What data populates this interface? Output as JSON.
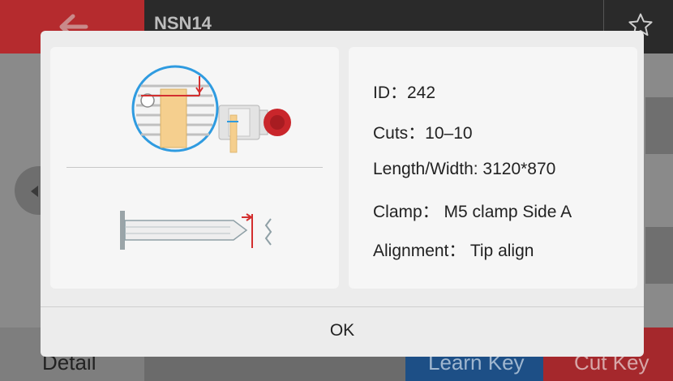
{
  "header": {
    "title": "NSN14",
    "back_icon": "arrow-left-icon",
    "favorite_icon": "star-icon"
  },
  "footer": {
    "detail_label": "Detail",
    "learn_key_label": "Learn Key",
    "cut_key_label": "Cut Key"
  },
  "dialog": {
    "id_text": "ID：242",
    "cuts_text": "Cuts：10–10",
    "length_width_text": "Length/Width: 3120*870",
    "clamp_text": "Clamp： M5 clamp Side A",
    "alignment_text": "Alignment： Tip align",
    "ok_label": "OK"
  },
  "colors": {
    "accent_red": "#d32f2f",
    "accent_blue": "#2f9be0",
    "key_tan": "#f5cf8e"
  }
}
